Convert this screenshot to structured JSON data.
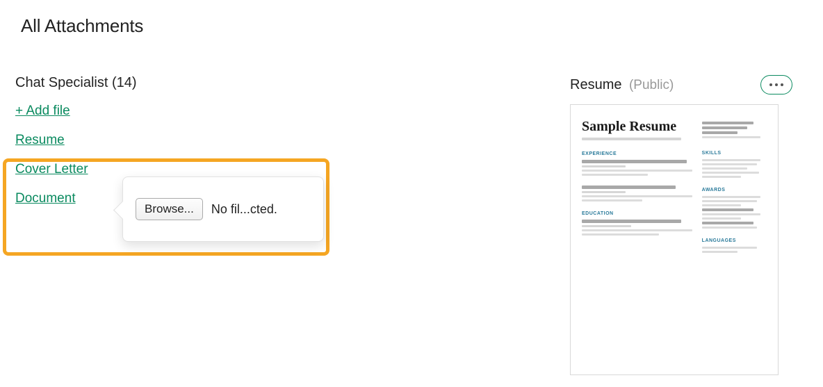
{
  "page": {
    "title": "All Attachments"
  },
  "job": {
    "name": "Chat Specialist",
    "count": 14,
    "heading": "Chat Specialist (14)"
  },
  "links": {
    "add_file": "+ Add file",
    "resume": "Resume",
    "cover_letter": "Cover Letter",
    "document": "Document"
  },
  "popover": {
    "browse_label": "Browse...",
    "file_status": "No fil...cted."
  },
  "preview": {
    "title": "Resume",
    "visibility": "(Public)",
    "doc_title": "Sample Resume",
    "sections": {
      "experience": "EXPERIENCE",
      "education": "EDUCATION",
      "skills": "SKILLS",
      "awards": "AWARDS",
      "languages": "LANGUAGES"
    }
  }
}
